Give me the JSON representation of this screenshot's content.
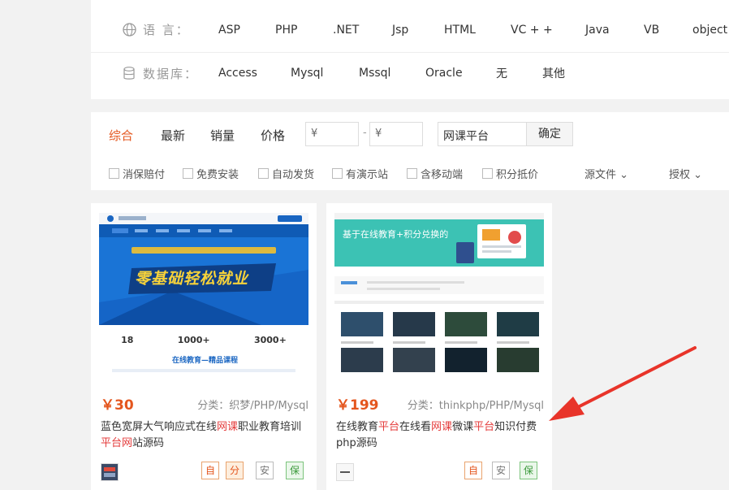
{
  "filters": {
    "language": {
      "label": "语 言：",
      "icon": "globe-icon",
      "options": [
        "ASP",
        "PHP",
        ".NET",
        "Jsp",
        "HTML",
        "VC + +",
        "Java",
        "VB",
        "object"
      ]
    },
    "database": {
      "label": "数据库：",
      "icon": "database-icon",
      "options": [
        "Access",
        "Mysql",
        "Mssql",
        "Oracle",
        "无",
        "其他"
      ]
    }
  },
  "sort": {
    "tabs": [
      "综合",
      "最新",
      "销量",
      "价格"
    ],
    "active_tab": "综合",
    "price_from_placeholder": "¥",
    "price_dash": "-",
    "price_to_placeholder": "¥",
    "keyword": "网课平台",
    "confirm_label": "确定",
    "checkboxes": [
      "消保赔付",
      "免费安装",
      "自动发货",
      "有演示站",
      "含移动端",
      "积分抵价"
    ],
    "dropdowns": [
      "源文件",
      "授权"
    ]
  },
  "products": [
    {
      "price": "￥30",
      "category": "分类：织梦/PHP/Mysql",
      "title_segments": [
        {
          "text": "蓝色宽屏大气响应式在线",
          "hl": false
        },
        {
          "text": "网课",
          "hl": true
        },
        {
          "text": "职业教育培训",
          "hl": false
        },
        {
          "text": "平台网",
          "hl": true
        },
        {
          "text": "站源码",
          "hl": false
        }
      ],
      "badges": [
        "自",
        "分",
        "安",
        "保"
      ],
      "thumb": {
        "banner_text": "零基础轻松就业",
        "sub_text": "在线教育—精品课程",
        "stats": [
          "18",
          "1000+",
          "3000+"
        ]
      }
    },
    {
      "price": "￥199",
      "category": "分类：thinkphp/PHP/Mysql",
      "title_segments": [
        {
          "text": "在线教育",
          "hl": false
        },
        {
          "text": "平台",
          "hl": true
        },
        {
          "text": "在线看",
          "hl": false
        },
        {
          "text": "网课",
          "hl": true
        },
        {
          "text": "微课",
          "hl": false
        },
        {
          "text": "平台",
          "hl": true
        },
        {
          "text": "知识付费php源码",
          "hl": false
        }
      ],
      "badges": [
        "自",
        "安",
        "保"
      ],
      "thumb": {
        "banner_text": "基于在线教育+积分兑换的"
      }
    }
  ],
  "colors": {
    "accent": "#e4561e",
    "highlight": "#e43b3b",
    "arrow": "#e8342a"
  }
}
